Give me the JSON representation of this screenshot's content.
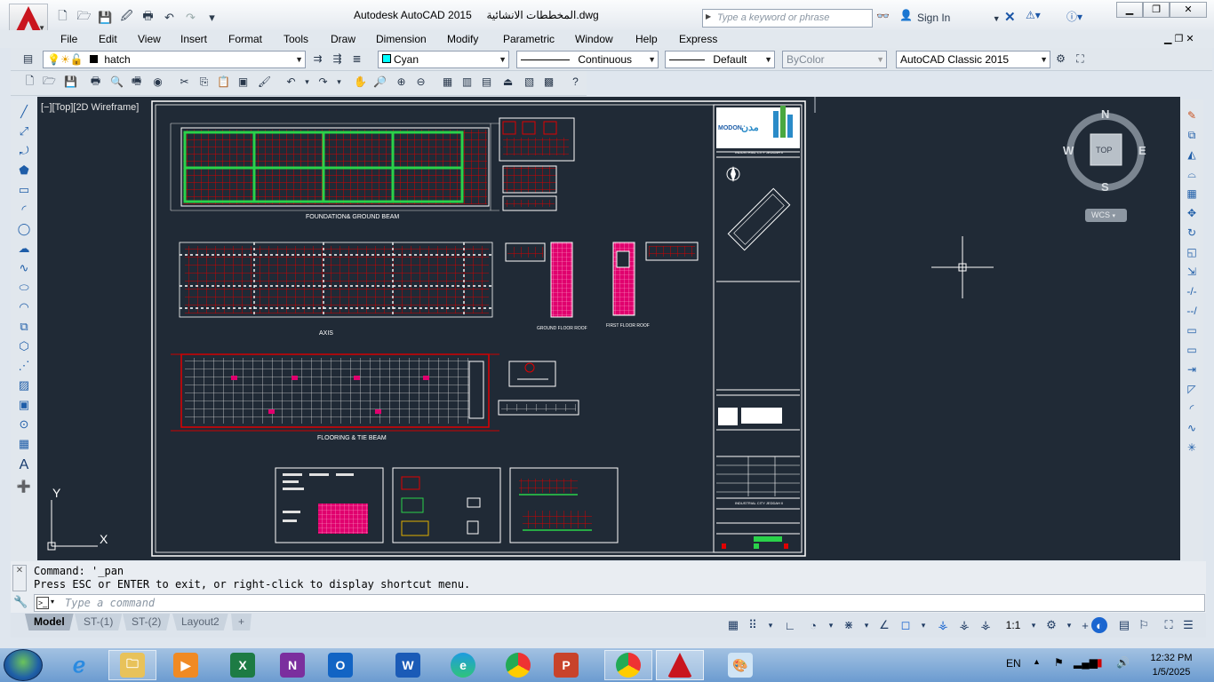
{
  "app": {
    "window_title": "Autodesk AutoCAD 2015",
    "filename": "المخططات الانشائية.dwg"
  },
  "search": {
    "placeholder": "Type a keyword or phrase"
  },
  "signin": {
    "label": "Sign In"
  },
  "menu": [
    "File",
    "Edit",
    "View",
    "Insert",
    "Format",
    "Tools",
    "Draw",
    "Dimension",
    "Modify",
    "Parametric",
    "Window",
    "Help",
    "Express"
  ],
  "properties": {
    "layer": "hatch",
    "color": "Cyan",
    "color_hex": "#00ffff",
    "linetype": "Continuous",
    "lineweight": "Default",
    "plotstyle": "ByColor",
    "workspace": "AutoCAD Classic 2015"
  },
  "viewport": {
    "label": "[−][Top][2D Wireframe]"
  },
  "viewcube": {
    "n": "N",
    "s": "S",
    "e": "E",
    "w": "W",
    "face": "TOP",
    "wcs": "WCS"
  },
  "ucs": {
    "x": "X",
    "y": "Y"
  },
  "sheet": {
    "plan1": "FOUNDATION& GROUND BEAM",
    "plan2": "AXIS",
    "plan3": "FLOORING & TIE BEAM",
    "col1": "GROUND FLOOR ROOF",
    "col2": "FIRST FLOOR ROOF",
    "logo": "MODON",
    "logo_ar": "مدن",
    "tb_head": "INDUSTRIAL CITY JEDDAH II"
  },
  "command": {
    "line1": "Command: '_pan",
    "line2": "Press ESC or ENTER to exit, or right-click to display shortcut menu.",
    "placeholder": "Type a command"
  },
  "layout_tabs": [
    "Model",
    "ST-(1)",
    "ST-(2)",
    "Layout2"
  ],
  "status": {
    "scale": "1:1"
  },
  "taskbar": {
    "lang": "EN",
    "time": "12:32 PM",
    "date": "1/5/2025"
  },
  "colors": {
    "background": "#202a36",
    "hatch_red": "#d20000",
    "grid_green": "#2ad24a",
    "magenta": "#e0006e"
  }
}
